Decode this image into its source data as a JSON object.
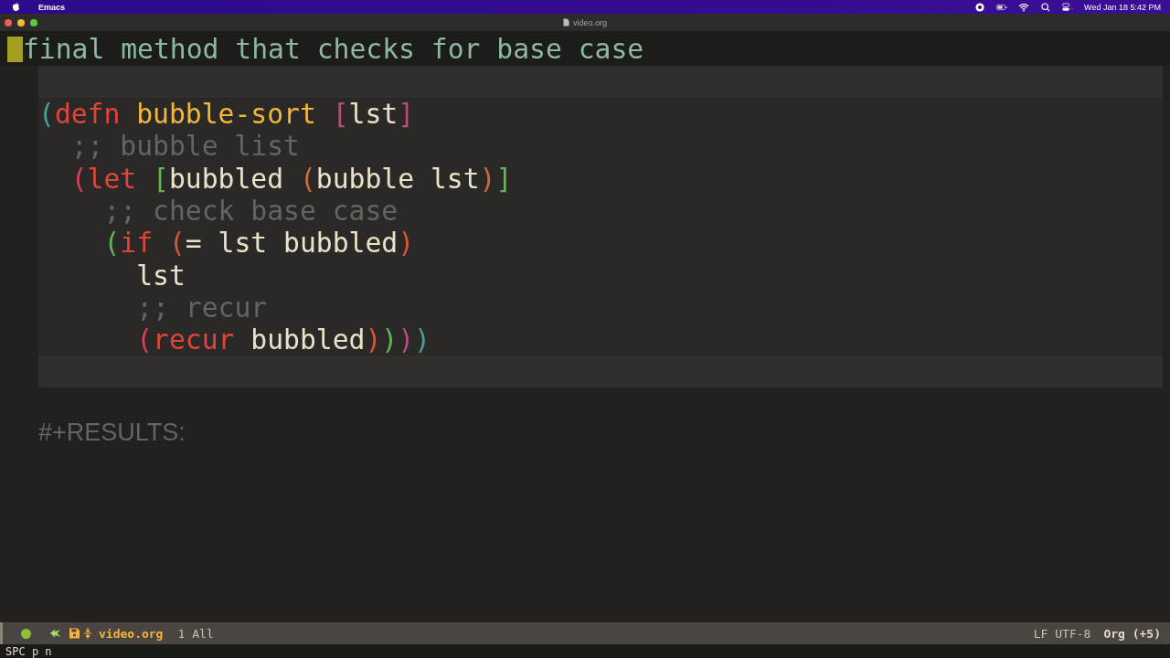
{
  "menu_bar": {
    "app": "Emacs",
    "clock": "Wed Jan 18  5:42 PM"
  },
  "window": {
    "title": "video.org"
  },
  "heading": "final method that checks for base case",
  "code": [
    {
      "tokens": [
        {
          "text": "(",
          "color": "#4a9e96"
        },
        {
          "text": "defn",
          "color": "#e0453a"
        },
        {
          "text": " bubble-sort",
          "color": "#f2b63c"
        },
        {
          "text": " [",
          "color": "#b4507c"
        },
        {
          "text": "lst",
          "color": "#ebe3c8"
        },
        {
          "text": "]",
          "color": "#b4507c"
        }
      ],
      "children": [
        {
          "tokens": [
            {
              "text": ";; bubble list",
              "color": "#66645e"
            }
          ]
        },
        {
          "tokens": [
            {
              "text": "(",
              "color": "#d2425e"
            },
            {
              "text": "let",
              "color": "#e0453a"
            },
            {
              "text": " [",
              "color": "#62b458"
            },
            {
              "text": "bubbled",
              "color": "#ebe3c8"
            },
            {
              "text": " (",
              "color": "#d06a38"
            },
            {
              "text": "bubble lst",
              "color": "#ebe3c8"
            },
            {
              "text": ")",
              "color": "#d06a38"
            },
            {
              "text": "]",
              "color": "#62b458"
            }
          ],
          "children": [
            {
              "tokens": [
                {
                  "text": ";; check base case",
                  "color": "#66645e"
                }
              ]
            },
            {
              "tokens": [
                {
                  "text": "(",
                  "color": "#62b458"
                },
                {
                  "text": "if",
                  "color": "#e0453a"
                },
                {
                  "text": " (",
                  "color": "#d2583a"
                },
                {
                  "text": "= lst bubbled",
                  "color": "#ebe3c8"
                },
                {
                  "text": ")",
                  "color": "#d2583a"
                }
              ],
              "children": [
                {
                  "tokens": [
                    {
                      "text": "lst",
                      "color": "#ebe3c8"
                    }
                  ]
                },
                {
                  "tokens": [
                    {
                      "text": ";; recur",
                      "color": "#66645e"
                    }
                  ]
                },
                {
                  "tokens": [
                    {
                      "text": "(",
                      "color": "#d2425e"
                    },
                    {
                      "text": "recur",
                      "color": "#e0453a"
                    },
                    {
                      "text": " bubbled",
                      "color": "#ebe3c8"
                    },
                    {
                      "text": ")",
                      "color": "#d2583a"
                    },
                    {
                      "text": ")",
                      "color": "#62b458"
                    },
                    {
                      "text": ")",
                      "color": "#b4507c"
                    },
                    {
                      "text": ")",
                      "color": "#4a9e96"
                    }
                  ]
                }
              ]
            }
          ]
        }
      ]
    }
  ],
  "results": "#+RESULTS:",
  "mode_line": {
    "buffer": "video.org",
    "line": "1",
    "position": "All",
    "encoding": "LF UTF-8",
    "mode": "Org (+5)"
  },
  "echo_area": "SPC p n"
}
